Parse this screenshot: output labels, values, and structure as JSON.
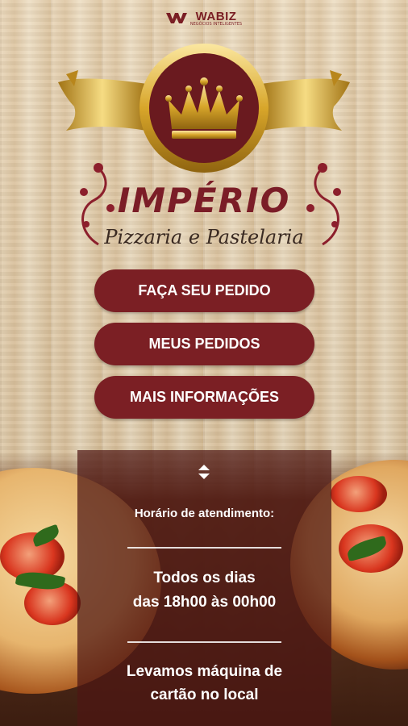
{
  "header": {
    "brand_name": "WABIZ",
    "brand_tagline": "NEGÓCIOS INTELIGENTES"
  },
  "restaurant": {
    "name": "IMPÉRIO",
    "subtitle": "Pizzaria e Pastelaria"
  },
  "menu": {
    "order_label": "FAÇA SEU PEDIDO",
    "my_orders_label": "MEUS PEDIDOS",
    "more_info_label": "MAIS INFORMAÇÕES"
  },
  "info_panel": {
    "heading": "Horário de atendimento:",
    "hours_line1": "Todos os dias",
    "hours_line2": "das 18h00 às 00h00",
    "card_line1": "Levamos máquina de",
    "card_line2": "cartão no local"
  },
  "colors": {
    "accent": "#7b1f24",
    "gold": "#d9a92c"
  },
  "icons": [
    "wabiz-logo-icon",
    "crown-icon",
    "ribbon-icon",
    "flourish-icon",
    "sort-icon"
  ]
}
